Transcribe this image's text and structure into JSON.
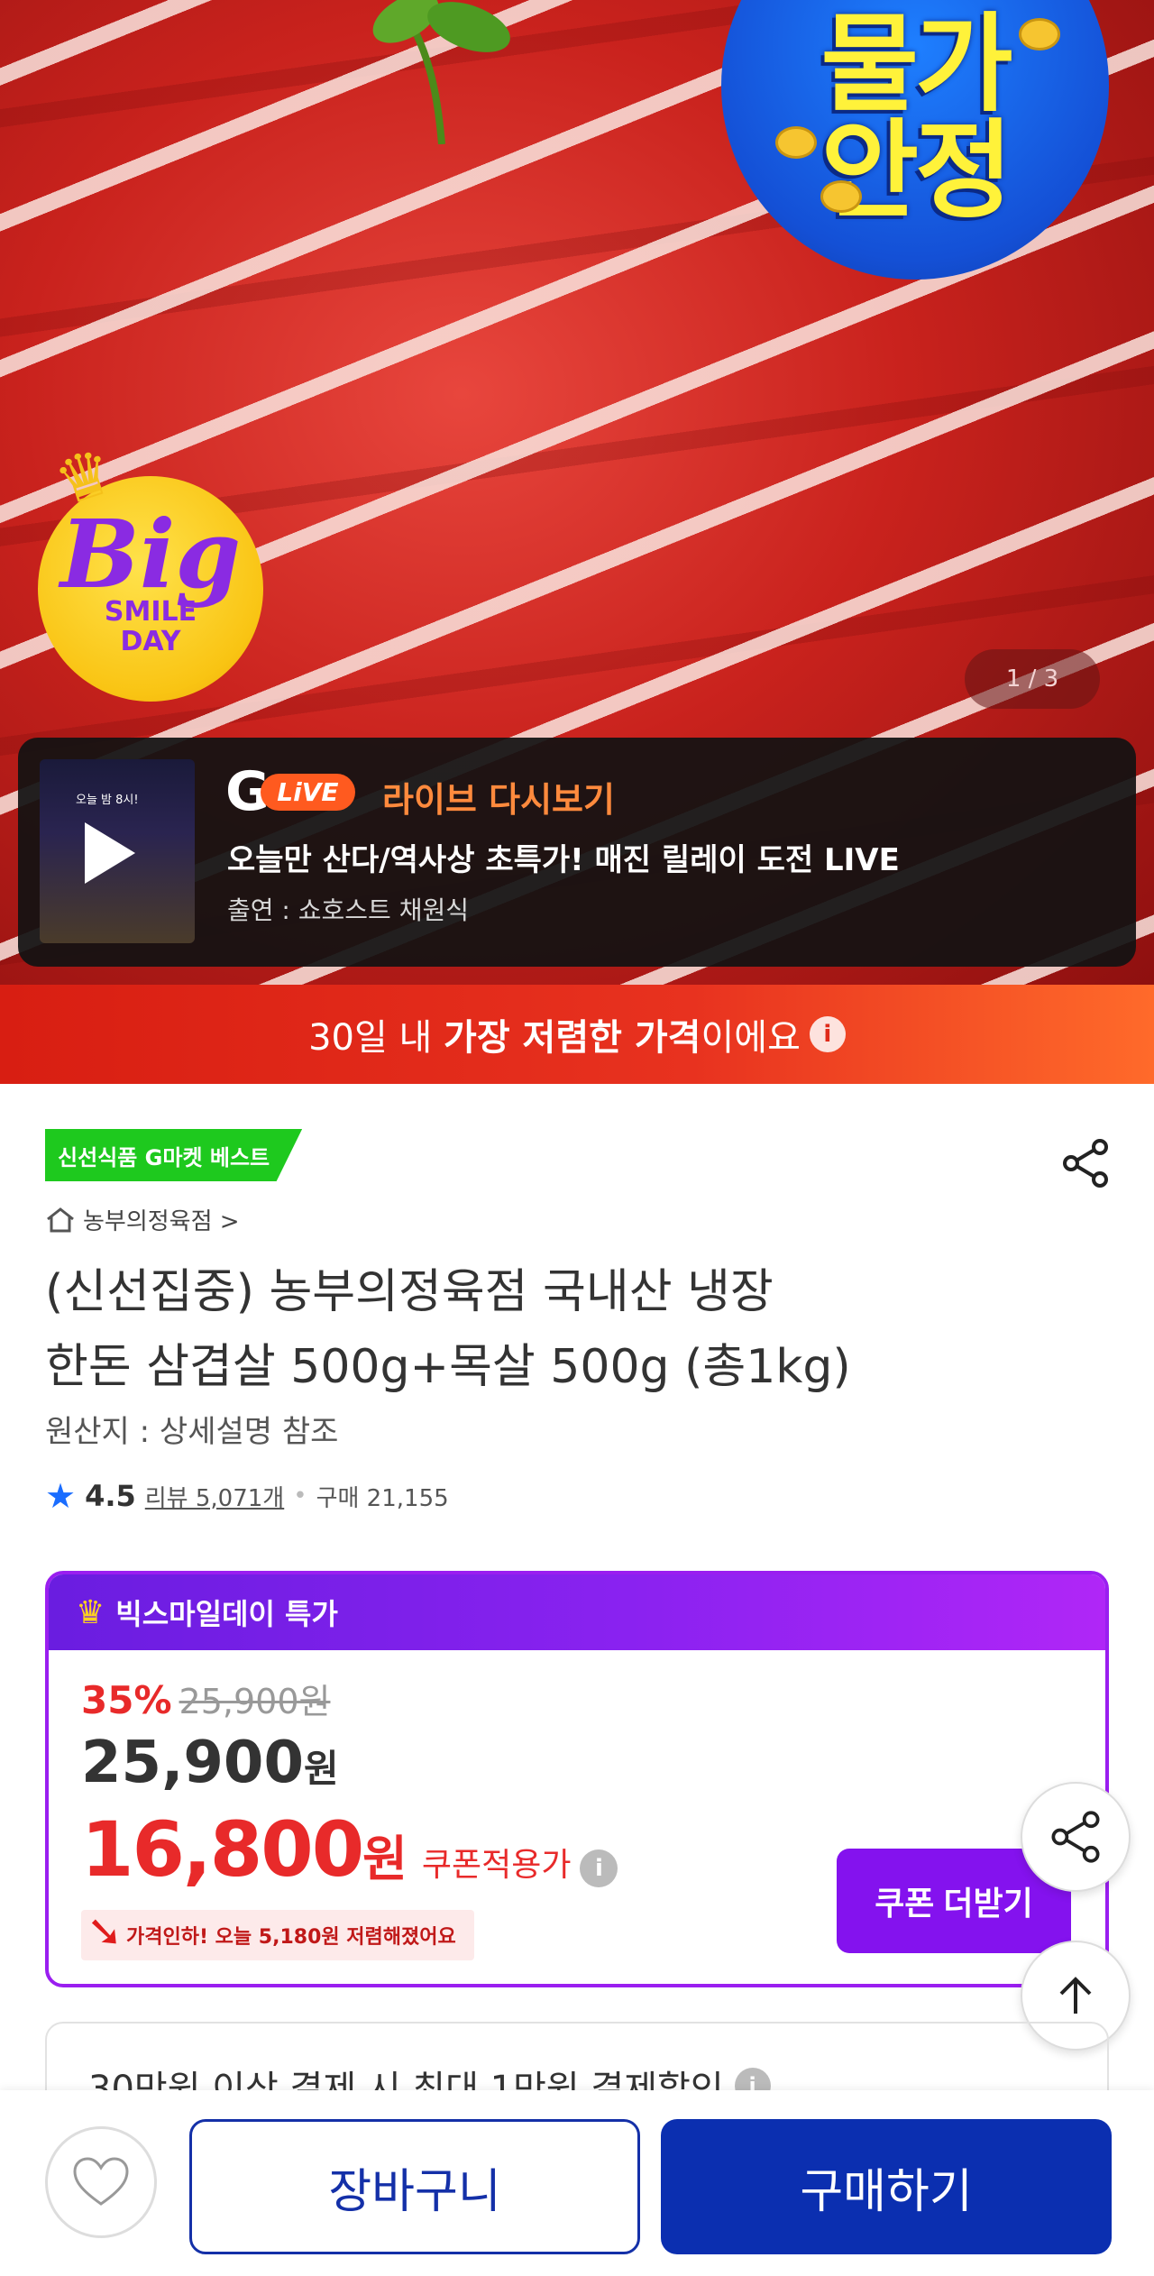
{
  "hero": {
    "badge_stable": {
      "line1": "물가",
      "line2": "안정"
    },
    "big_badge": {
      "big": "Big",
      "line1": "SMILE",
      "line2": "DAY"
    },
    "image_counter": "1 / 3",
    "live": {
      "g_logo": "G",
      "live_pill": "LiVE",
      "label": "라이브 다시보기",
      "description": "오늘만 산다/역사상 초특가! 매진 릴레이 도전 LIVE",
      "cast": "출연 : 쇼호스트 채원식",
      "thumb_text": "오늘 밤 8시!"
    }
  },
  "lowest_banner": {
    "pre": "30일 내 ",
    "bold": "가장 저렴한 가격",
    "post": "이에요",
    "info_icon": "i"
  },
  "product": {
    "best_tag": "신선식품 G마켓 베스트",
    "store_name": "농부의정육점 >",
    "title_line1": "(신선집중) 농부의정육점 국내산 냉장",
    "title_line2": "한돈 삼겹살 500g+목살 500g (총1kg)",
    "origin": "원산지 : 상세설명 참조",
    "rating": "4.5",
    "reviews": "리뷰 5,071개",
    "dot": "•",
    "purchases": "구매 21,155"
  },
  "promo": {
    "header": "빅스마일데이 특가",
    "discount_pct": "35%",
    "original_price": "25,900원",
    "sale_price": "25,900",
    "sale_won": "원",
    "coupon_price": "16,800",
    "coupon_won": "원",
    "coupon_label": "쿠폰적용가",
    "info_icon": "i",
    "price_drop": "가격인하! 오늘 5,180원 저렴해졌어요",
    "coupon_button": "쿠폰 더받기"
  },
  "payment_card": {
    "text": "30만원 이상 결제 시 최대 1만원 결제할인",
    "info_icon": "i"
  },
  "bottom": {
    "cart": "장바구니",
    "buy": "구매하기"
  },
  "colors": {
    "primary_blue": "#0b2fb0",
    "promo_purple": "#8412ee",
    "sale_red": "#e82a2a",
    "banner_red": "#d81e12",
    "best_green": "#1ec91e"
  }
}
